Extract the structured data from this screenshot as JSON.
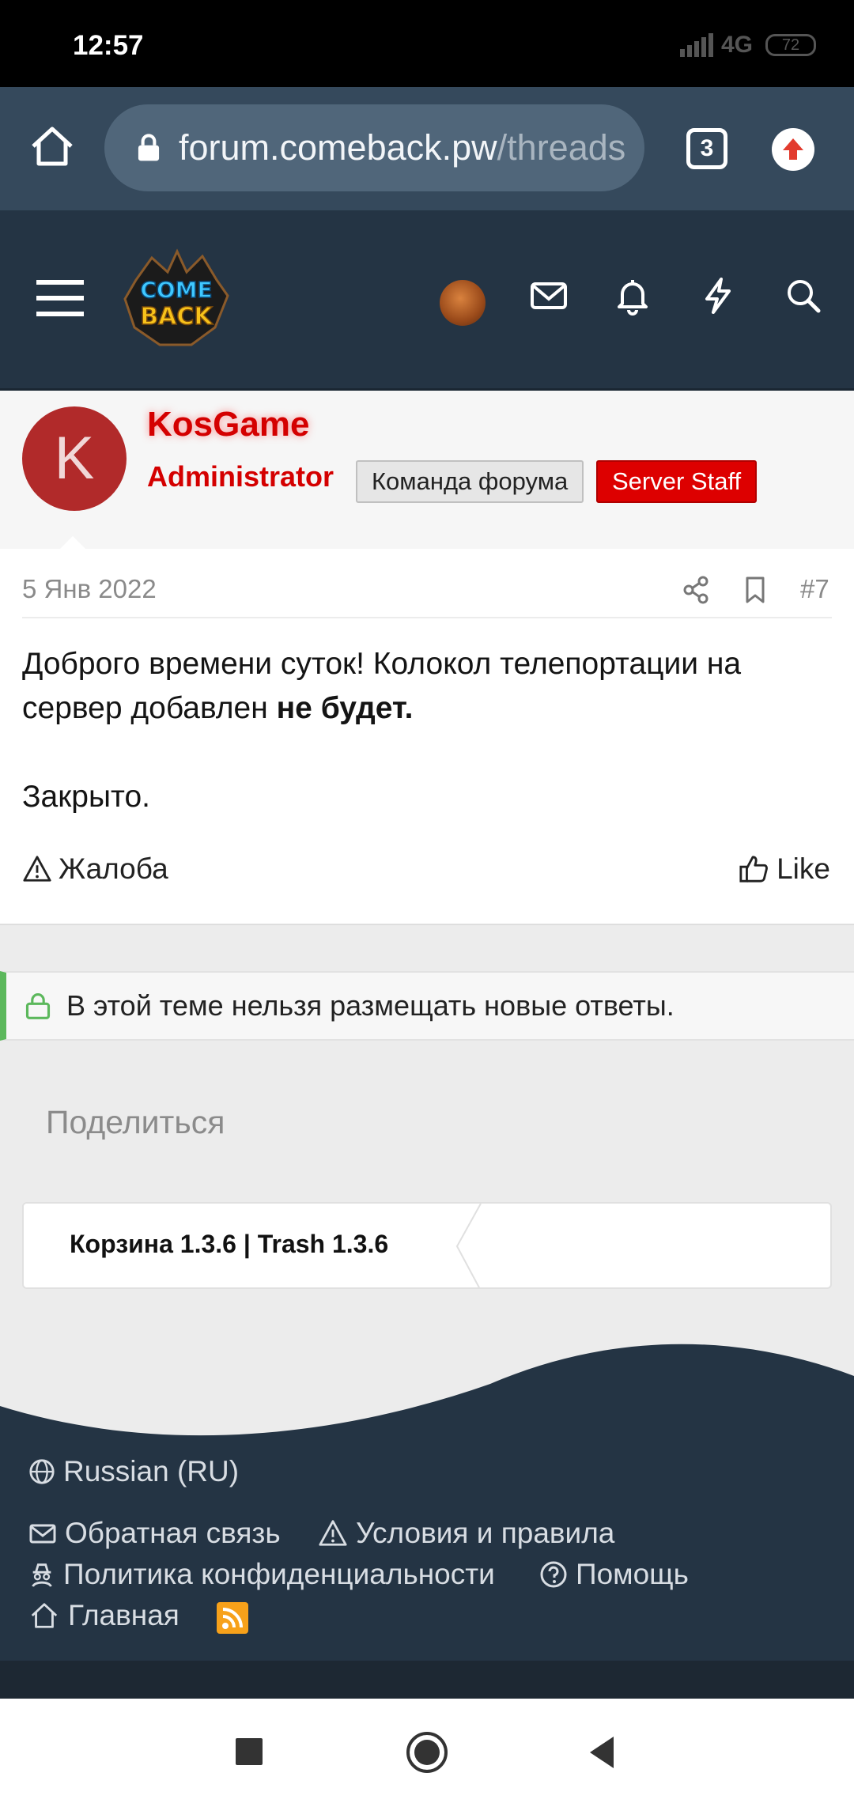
{
  "status_bar": {
    "time": "12:57",
    "network": "4G",
    "battery": "72"
  },
  "browser": {
    "url_main": "forum.comeback.pw",
    "url_rest": "/threads",
    "tab_count": "3"
  },
  "forum_header": {
    "logo_text": "COME BACK"
  },
  "post": {
    "author": "KosGame",
    "avatar_letter": "K",
    "role": "Administrator",
    "badges": [
      "Команда форума",
      "Server Staff"
    ],
    "date": "5 Янв 2022",
    "number": "#7",
    "text_part1": "Доброго времени суток! Колокол телепортации на сервер добавлен ",
    "text_bold": "не будет.",
    "text_part2": "Закрыто.",
    "report_label": "Жалоба",
    "like_label": "Like"
  },
  "notice": {
    "text": "В этой теме нельзя размещать новые ответы."
  },
  "share": {
    "title": "Поделиться"
  },
  "breadcrumb": {
    "current": "Корзина 1.3.6 | Trash 1.3.6"
  },
  "footer": {
    "language": "Russian (RU)",
    "links": [
      "Обратная связь",
      "Условия и правила",
      "Политика конфиденциальности",
      "Помощь",
      "Главная"
    ]
  },
  "colors": {
    "accent_red": "#d40000",
    "header_bg": "#243444",
    "browser_bg": "#35495c",
    "notice_green": "#5cb85c",
    "rss_orange": "#f7a11a"
  }
}
